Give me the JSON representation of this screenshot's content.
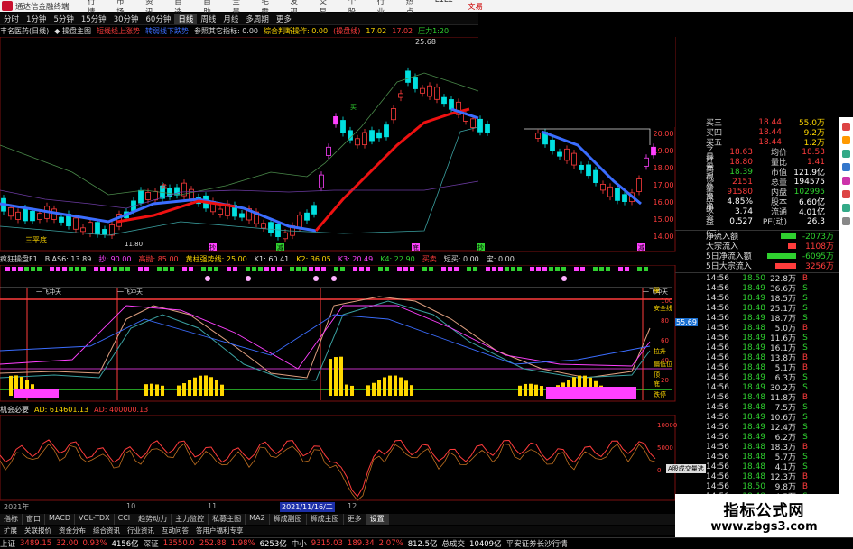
{
  "titlebar": {
    "app_name": "通达信金融终端",
    "menu": [
      "行情",
      "市场",
      "资讯",
      "自选",
      "自助",
      "全景",
      "毛霸",
      "发现",
      "交易",
      "个股",
      "行业",
      "热点",
      "L1L2"
    ],
    "right": "文易"
  },
  "periods": {
    "items": [
      "分时",
      "1分钟",
      "5分钟",
      "15分钟",
      "30分钟",
      "60分钟",
      "日线",
      "周线",
      "月线",
      "多周期",
      "更多"
    ],
    "active": "日线"
  },
  "indicator_row": [
    {
      "text": "丰名医药(日线)",
      "color": "#dddddd"
    },
    {
      "text": "◆ 操盘主图",
      "color": "#dddddd"
    },
    {
      "text": "短线线上涨势",
      "color": "#ff3c3c"
    },
    {
      "text": "转弱线下跌势",
      "color": "#3b6dff"
    },
    {
      "text": "参照其它指标: 0.00",
      "color": "#dddddd"
    },
    {
      "text": "综合判断操作: 0.00",
      "color": "#ffd800"
    },
    {
      "text": "(操盘线)",
      "color": "#ff3c3c"
    },
    {
      "text": "17.02",
      "color": "#ffd800"
    },
    {
      "text": "17.02",
      "color": "#ff3c3c"
    },
    {
      "text": "压力1:20",
      "color": "#2fd02f"
    }
  ],
  "main_chart": {
    "peak_label": "25.68",
    "low_label": "11.80",
    "bottom_markers": [
      "三平底"
    ],
    "bottom_signs": [
      "抄",
      "减",
      "底",
      "抄",
      "减"
    ],
    "callouts": [
      "卖",
      "买"
    ]
  },
  "price_axis": [
    "20.00",
    "19.00",
    "18.00",
    "17.00",
    "16.00",
    "15.00",
    "14.00"
  ],
  "kdj_header": [
    {
      "text": "疯狂操盘F1",
      "color": "#dddddd"
    },
    {
      "text": "BIAS6: 13.89",
      "color": "#dddddd"
    },
    {
      "text": "抄: 90.00",
      "color": "#ff40ff"
    },
    {
      "text": "高抛: 85.00",
      "color": "#ff3c3c"
    },
    {
      "text": "黄柱强势线: 25.00",
      "color": "#ffd800"
    },
    {
      "text": "K1: 60.41",
      "color": "#dddddd"
    },
    {
      "text": "K2: 36.05",
      "color": "#ffd800"
    },
    {
      "text": "K3: 20.49",
      "color": "#ff40ff"
    },
    {
      "text": "K4: 22.90",
      "color": "#2fd02f"
    },
    {
      "text": "买卖",
      "color": "#ff3c3c"
    },
    {
      "text": "短买: 0.00",
      "color": "#dddddd"
    },
    {
      "text": "宝: 0.00",
      "color": "#dddddd"
    }
  ],
  "kdj_chart": {
    "labels": [
      "一飞冲天",
      "一飞冲天",
      "一飞冲天"
    ],
    "right_labels": [
      "量",
      "安全线",
      "拉升",
      "偏低位",
      "顶",
      "底",
      "跌停"
    ],
    "price_tag": "55.69",
    "axis": [
      "100",
      "80",
      "60",
      "40",
      "20"
    ]
  },
  "ad_header": [
    {
      "text": "机会必要",
      "color": "#dddddd"
    },
    {
      "text": "AD: 614601.13",
      "color": "#ffd800"
    },
    {
      "text": "AD: 400000.13",
      "color": "#ff3c3c"
    }
  ],
  "ad_axis": [
    "10000",
    "5000",
    "0"
  ],
  "date_axis": [
    {
      "text": "2021年",
      "hl": false
    },
    {
      "text": "10",
      "hl": false
    },
    {
      "text": "11",
      "hl": false
    },
    {
      "text": "2021/11/16/二",
      "hl": true
    },
    {
      "text": "12",
      "hl": false
    }
  ],
  "tab_strip": {
    "items": [
      "指标",
      "窗口",
      "MACD",
      "VOL-TDX",
      "CCI",
      "趋势动力",
      "主力监控",
      "私募主图",
      "MA2",
      "狮成副图",
      "狮成主图",
      "更多",
      "设置"
    ],
    "active": "设置"
  },
  "sub_tabs": [
    "扩展",
    "关联报价",
    "资金分布",
    "综合资讯",
    "行业资讯",
    "互动问答",
    "答用户福利专享"
  ],
  "orderbook": [
    {
      "k": "买三",
      "v": "18.44",
      "v2": "55.0万",
      "color": "red"
    },
    {
      "k": "买四",
      "v": "18.44",
      "v2": "9.2万",
      "color": "red"
    },
    {
      "k": "买五",
      "v": "18.44",
      "v2": "1.2万",
      "color": "red"
    }
  ],
  "quote": [
    {
      "k": "今开",
      "v": "18.63",
      "k2": "均价",
      "v2": "18.53",
      "c1": "red",
      "c2": "red"
    },
    {
      "k": "最高",
      "v": "18.80",
      "k2": "量比",
      "v2": "1.41",
      "c1": "red",
      "c2": "red"
    },
    {
      "k": "最低",
      "v": "18.39",
      "k2": "市值",
      "v2": "121.9亿",
      "c1": "green",
      "c2": "white"
    },
    {
      "k": "现量",
      "v": "2151",
      "k2": "总量",
      "v2": "194575",
      "c1": "red",
      "c2": "white"
    },
    {
      "k": "外盘",
      "v": "91580",
      "k2": "内盘",
      "v2": "102995",
      "c1": "red",
      "c2": "green"
    },
    {
      "k": "换手",
      "v": "4.85%",
      "k2": "股本",
      "v2": "6.60亿",
      "c1": "white",
      "c2": "white"
    },
    {
      "k": "净资",
      "v": "3.74",
      "k2": "流通",
      "v2": "4.01亿",
      "c1": "white",
      "c2": "white"
    },
    {
      "k": "收益(三)",
      "v": "0.527",
      "k2": "PE(动)",
      "v2": "26.3",
      "c1": "white",
      "c2": "white"
    }
  ],
  "flow": [
    {
      "label": "净流入额",
      "value": "-2073万",
      "bar": 0.45,
      "color": "#2fd02f",
      "vcolor": "green"
    },
    {
      "label": "大宗流入",
      "value": "1108万",
      "bar": 0.25,
      "color": "#ff3c3c",
      "vcolor": "red"
    },
    {
      "label": "5日净流入额",
      "value": "-6095万",
      "bar": 0.85,
      "color": "#2fd02f",
      "vcolor": "green"
    },
    {
      "label": "5日大宗流入",
      "value": "3256万",
      "bar": 0.6,
      "color": "#ff3c3c",
      "vcolor": "red"
    }
  ],
  "ticks": [
    {
      "t": "14:56",
      "p": "18.50",
      "v": "22.8万",
      "s": "B"
    },
    {
      "t": "14:56",
      "p": "18.49",
      "v": "36.6万",
      "s": "S"
    },
    {
      "t": "14:56",
      "p": "18.49",
      "v": "18.5万",
      "s": "S"
    },
    {
      "t": "14:56",
      "p": "18.48",
      "v": "25.1万",
      "s": "S"
    },
    {
      "t": "14:56",
      "p": "18.49",
      "v": "18.7万",
      "s": "S"
    },
    {
      "t": "14:56",
      "p": "18.48",
      "v": "5.0万",
      "s": "B"
    },
    {
      "t": "14:56",
      "p": "18.49",
      "v": "11.6万",
      "s": "S"
    },
    {
      "t": "14:56",
      "p": "18.49",
      "v": "16.1万",
      "s": "S"
    },
    {
      "t": "14:56",
      "p": "18.48",
      "v": "13.8万",
      "s": "B"
    },
    {
      "t": "14:56",
      "p": "18.48",
      "v": "5.1万",
      "s": "B"
    },
    {
      "t": "14:56",
      "p": "18.49",
      "v": "6.3万",
      "s": "S"
    },
    {
      "t": "14:56",
      "p": "18.49",
      "v": "30.2万",
      "s": "S"
    },
    {
      "t": "14:56",
      "p": "18.48",
      "v": "11.8万",
      "s": "B"
    },
    {
      "t": "14:56",
      "p": "18.48",
      "v": "7.5万",
      "s": "S"
    },
    {
      "t": "14:56",
      "p": "18.49",
      "v": "10.6万",
      "s": "S"
    },
    {
      "t": "14:56",
      "p": "18.49",
      "v": "12.4万",
      "s": "S"
    },
    {
      "t": "14:56",
      "p": "18.49",
      "v": "6.2万",
      "s": "S"
    },
    {
      "t": "14:56",
      "p": "18.48",
      "v": "18.3万",
      "s": "B"
    },
    {
      "t": "14:56",
      "p": "18.48",
      "v": "5.7万",
      "s": "S"
    },
    {
      "t": "14:56",
      "p": "18.48",
      "v": "4.1万",
      "s": "S"
    },
    {
      "t": "14:56",
      "p": "18.48",
      "v": "12.3万",
      "s": "B"
    },
    {
      "t": "14:56",
      "p": "18.50",
      "v": "9.8万",
      "s": "B"
    },
    {
      "t": "14:56",
      "p": "18.48",
      "v": "4.5万",
      "s": "S"
    }
  ],
  "tooltip": "A股成交量选",
  "watermark": {
    "line1": "指标公式网",
    "line2": "www.zbgs3.com"
  },
  "statusbar": [
    {
      "text": "上证",
      "color": "#dddddd"
    },
    {
      "text": "3489.15",
      "color": "#ff3c3c"
    },
    {
      "text": "32.00",
      "color": "#ff3c3c"
    },
    {
      "text": "0.93%",
      "color": "#ff3c3c"
    },
    {
      "text": "4156亿",
      "color": "#ffffff"
    },
    {
      "text": "深证",
      "color": "#dddddd"
    },
    {
      "text": "13550.0",
      "color": "#ff3c3c"
    },
    {
      "text": "252.88",
      "color": "#ff3c3c"
    },
    {
      "text": "1.98%",
      "color": "#ff3c3c"
    },
    {
      "text": "6253亿",
      "color": "#ffffff"
    },
    {
      "text": "中小",
      "color": "#dddddd"
    },
    {
      "text": "9315.03",
      "color": "#ff3c3c"
    },
    {
      "text": "189.34",
      "color": "#ff3c3c"
    },
    {
      "text": "2.07%",
      "color": "#ff3c3c"
    },
    {
      "text": "812.5亿",
      "color": "#ffffff"
    },
    {
      "text": "总成交",
      "color": "#dddddd"
    },
    {
      "text": "10409亿",
      "color": "#ffffff"
    },
    {
      "text": "平安证券长沙行情",
      "color": "#dddddd"
    }
  ],
  "colors": {
    "up": "#ff3c3c",
    "down": "#00e0e0",
    "ma_red": "#e11",
    "ma_blue": "#3b6dff",
    "yellow": "#ffd800",
    "magenta": "#ff40ff",
    "green": "#2fd02f"
  }
}
